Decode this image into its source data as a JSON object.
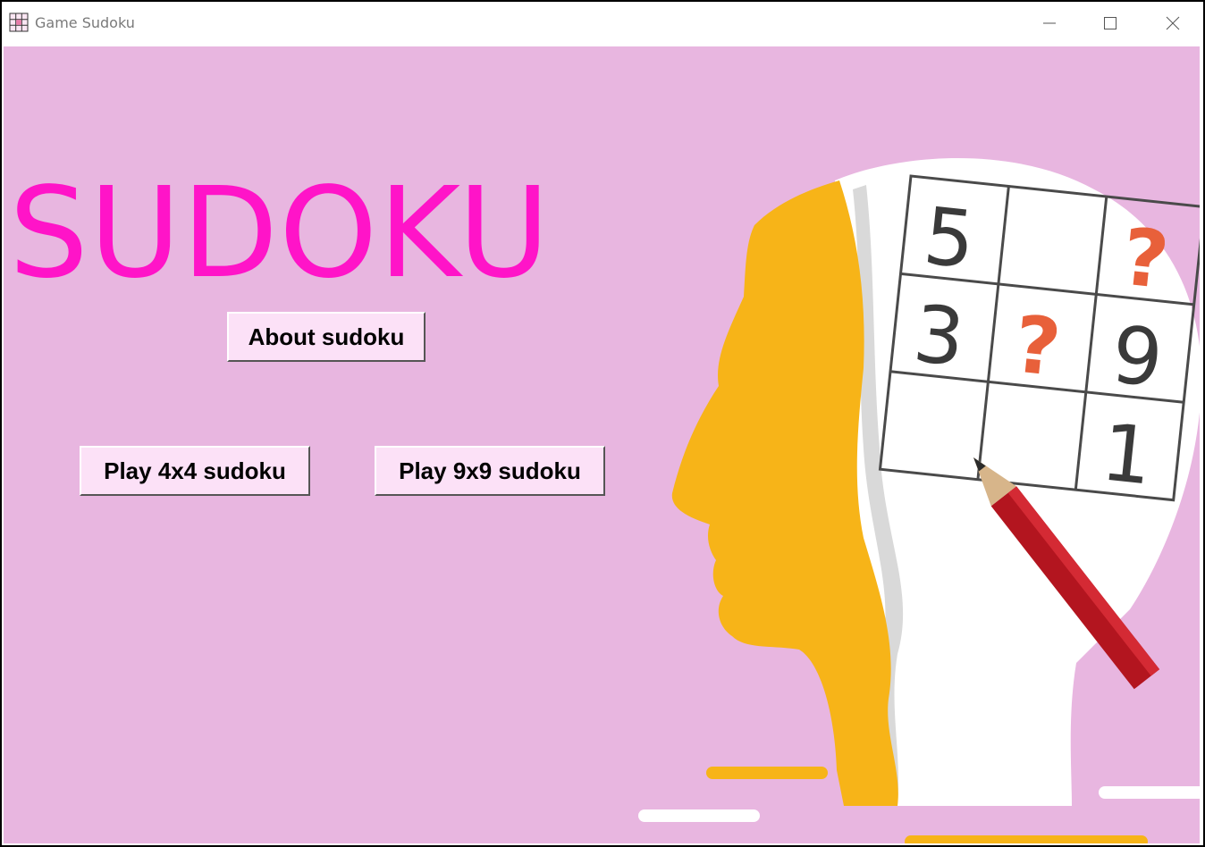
{
  "window": {
    "title": "Game Sudoku",
    "controls": [
      "minimize",
      "maximize",
      "close"
    ]
  },
  "main": {
    "logo_text": "SUDOKU",
    "buttons": {
      "about": "About sudoku",
      "play_4x4": "Play 4x4 sudoku",
      "play_9x9": "Play 9x9 sudoku"
    },
    "illustration": {
      "grid_digits": [
        "5",
        "3",
        "9",
        "1"
      ],
      "grid_question_marks": [
        "?",
        "?"
      ]
    }
  },
  "colors": {
    "background": "#e8b6e0",
    "logo": "#ff14c8",
    "button_face": "#fce1f7",
    "head_silhouette": "#f7b418",
    "question_mark": "#e8603a",
    "pencil": "#b3151f"
  }
}
